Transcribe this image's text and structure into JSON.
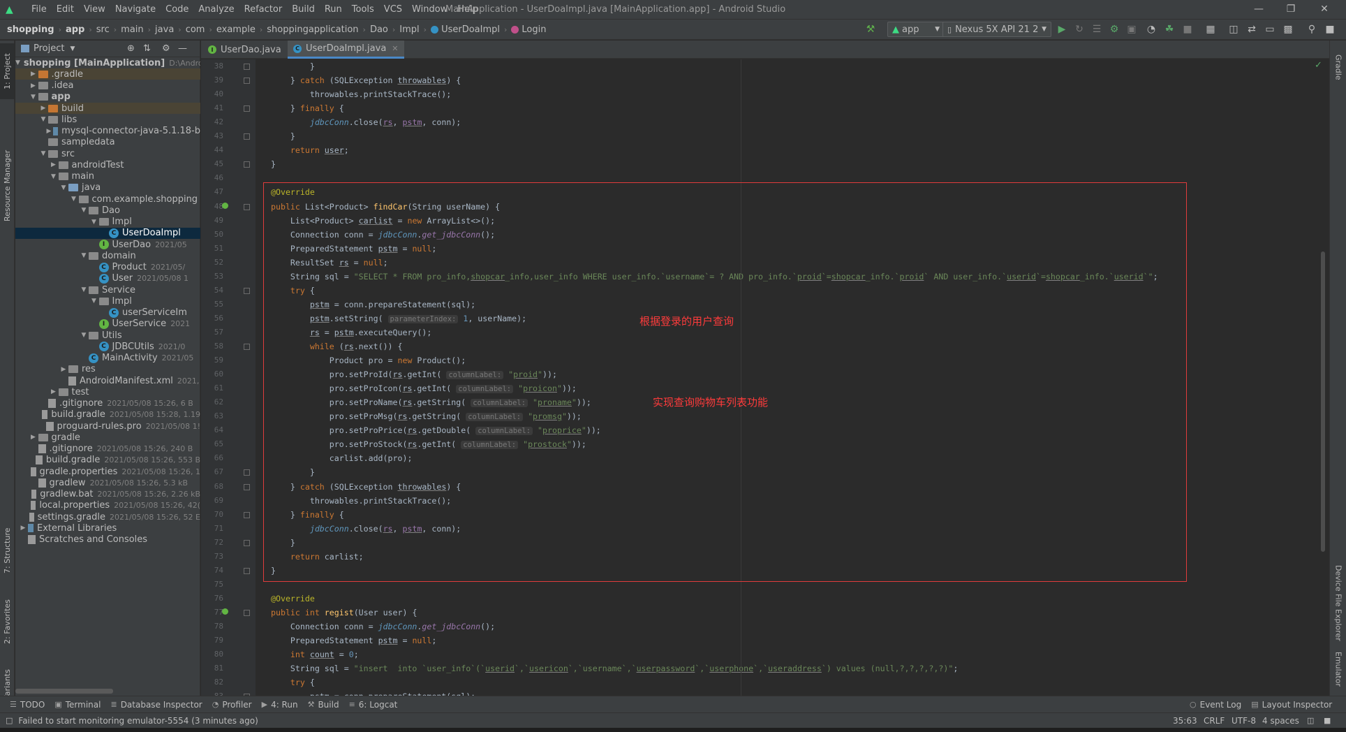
{
  "menubar": {
    "items": [
      "File",
      "Edit",
      "View",
      "Navigate",
      "Code",
      "Analyze",
      "Refactor",
      "Build",
      "Run",
      "Tools",
      "VCS",
      "Window",
      "Help"
    ],
    "title": "MainApplication - UserDoaImpl.java [MainApplication.app] - Android Studio"
  },
  "breadcrumb": [
    "shopping",
    "app",
    "src",
    "main",
    "java",
    "com",
    "example",
    "shoppingapplication",
    "Dao",
    "Impl",
    "UserDoaImpl",
    "Login"
  ],
  "toolbar": {
    "config": "app",
    "device": "Nexus 5X API 21 2"
  },
  "left_tabs": {
    "project": "1: Project",
    "resource": "Resource Manager",
    "structure": "7: Structure",
    "favorites": "2: Favorites",
    "variants": "Build Variants"
  },
  "right_tabs": {
    "gradle": "Gradle",
    "device_explorer": "Device File Explorer",
    "emulator": "Emulator"
  },
  "project_panel": {
    "title": "Project"
  },
  "tree": [
    {
      "label": "shopping [MainApplication]",
      "meta": "D:\\Andro",
      "depth": 0,
      "arrow": "open",
      "icon": "folder",
      "bold": true
    },
    {
      "label": ".gradle",
      "meta": "",
      "depth": 1,
      "arrow": "closed",
      "icon": "folder-o",
      "hl": true
    },
    {
      "label": ".idea",
      "meta": "",
      "depth": 1,
      "arrow": "closed",
      "icon": "folder"
    },
    {
      "label": "app",
      "meta": "",
      "depth": 1,
      "arrow": "open",
      "icon": "folder",
      "bold": true
    },
    {
      "label": "build",
      "meta": "",
      "depth": 2,
      "arrow": "closed",
      "icon": "folder-o",
      "hl": true
    },
    {
      "label": "libs",
      "meta": "",
      "depth": 2,
      "arrow": "open",
      "icon": "folder"
    },
    {
      "label": "mysql-connector-java-5.1.18-b",
      "meta": "",
      "depth": 3,
      "arrow": "closed",
      "icon": "lib"
    },
    {
      "label": "sampledata",
      "meta": "",
      "depth": 2,
      "arrow": "",
      "icon": "folder"
    },
    {
      "label": "src",
      "meta": "",
      "depth": 2,
      "arrow": "open",
      "icon": "folder"
    },
    {
      "label": "androidTest",
      "meta": "",
      "depth": 3,
      "arrow": "closed",
      "icon": "folder"
    },
    {
      "label": "main",
      "meta": "",
      "depth": 3,
      "arrow": "open",
      "icon": "folder"
    },
    {
      "label": "java",
      "meta": "",
      "depth": 4,
      "arrow": "open",
      "icon": "folder-b"
    },
    {
      "label": "com.example.shopping",
      "meta": "",
      "depth": 5,
      "arrow": "open",
      "icon": "folder"
    },
    {
      "label": "Dao",
      "meta": "",
      "depth": 6,
      "arrow": "open",
      "icon": "folder"
    },
    {
      "label": "Impl",
      "meta": "",
      "depth": 7,
      "arrow": "open",
      "icon": "folder"
    },
    {
      "label": "UserDoaImpl",
      "meta": "",
      "depth": 8,
      "arrow": "",
      "icon": "cls",
      "sel": true
    },
    {
      "label": "UserDao",
      "meta": "2021/05",
      "depth": 7,
      "arrow": "",
      "icon": "int"
    },
    {
      "label": "domain",
      "meta": "",
      "depth": 6,
      "arrow": "open",
      "icon": "folder"
    },
    {
      "label": "Product",
      "meta": "2021/05/",
      "depth": 7,
      "arrow": "",
      "icon": "cls"
    },
    {
      "label": "User",
      "meta": "2021/05/08 1",
      "depth": 7,
      "arrow": "",
      "icon": "cls"
    },
    {
      "label": "Service",
      "meta": "",
      "depth": 6,
      "arrow": "open",
      "icon": "folder"
    },
    {
      "label": "Impl",
      "meta": "",
      "depth": 7,
      "arrow": "open",
      "icon": "folder"
    },
    {
      "label": "userServiceIm",
      "meta": "",
      "depth": 8,
      "arrow": "",
      "icon": "cls"
    },
    {
      "label": "UserService",
      "meta": "2021",
      "depth": 7,
      "arrow": "",
      "icon": "int"
    },
    {
      "label": "Utils",
      "meta": "",
      "depth": 6,
      "arrow": "open",
      "icon": "folder"
    },
    {
      "label": "JDBCUtils",
      "meta": "2021/0",
      "depth": 7,
      "arrow": "",
      "icon": "cls"
    },
    {
      "label": "MainActivity",
      "meta": "2021/05",
      "depth": 6,
      "arrow": "",
      "icon": "cls"
    },
    {
      "label": "res",
      "meta": "",
      "depth": 4,
      "arrow": "closed",
      "icon": "folder"
    },
    {
      "label": "AndroidManifest.xml",
      "meta": "2021,",
      "depth": 4,
      "arrow": "",
      "icon": "file"
    },
    {
      "label": "test",
      "meta": "",
      "depth": 3,
      "arrow": "closed",
      "icon": "folder"
    },
    {
      "label": ".gitignore",
      "meta": "2021/05/08 15:26, 6 B",
      "depth": 2,
      "arrow": "",
      "icon": "file"
    },
    {
      "label": "build.gradle",
      "meta": "2021/05/08 15:28, 1.19",
      "depth": 2,
      "arrow": "",
      "icon": "file"
    },
    {
      "label": "proguard-rules.pro",
      "meta": "2021/05/08 1!",
      "depth": 2,
      "arrow": "",
      "icon": "file"
    },
    {
      "label": "gradle",
      "meta": "",
      "depth": 1,
      "arrow": "closed",
      "icon": "folder"
    },
    {
      "label": ".gitignore",
      "meta": "2021/05/08 15:26, 240 B",
      "depth": 1,
      "arrow": "",
      "icon": "file"
    },
    {
      "label": "build.gradle",
      "meta": "2021/05/08 15:26, 553 B",
      "depth": 1,
      "arrow": "",
      "icon": "file"
    },
    {
      "label": "gradle.properties",
      "meta": "2021/05/08 15:26, 1",
      "depth": 1,
      "arrow": "",
      "icon": "file"
    },
    {
      "label": "gradlew",
      "meta": "2021/05/08 15:26, 5.3 kB",
      "depth": 1,
      "arrow": "",
      "icon": "file"
    },
    {
      "label": "gradlew.bat",
      "meta": "2021/05/08 15:26, 2.26 kB",
      "depth": 1,
      "arrow": "",
      "icon": "file"
    },
    {
      "label": "local.properties",
      "meta": "2021/05/08 15:26, 42(",
      "depth": 1,
      "arrow": "",
      "icon": "file"
    },
    {
      "label": "settings.gradle",
      "meta": "2021/05/08 15:26, 52 E",
      "depth": 1,
      "arrow": "",
      "icon": "file"
    },
    {
      "label": "External Libraries",
      "meta": "",
      "depth": 0,
      "arrow": "closed",
      "icon": "lib"
    },
    {
      "label": "Scratches and Consoles",
      "meta": "",
      "depth": 0,
      "arrow": "",
      "icon": "file"
    }
  ],
  "editor_tabs": [
    {
      "label": "UserDao.java",
      "kind": "int"
    },
    {
      "label": "UserDoaImpl.java",
      "kind": "cls",
      "active": true
    }
  ],
  "line_start": 38,
  "code_lines": [
    "        }",
    "    } <k>catch</k> (SQLException <u>throwables</u>) {",
    "        throwables.printStackTrace();",
    "    } <k>finally</k> {",
    "        <s2>jdbcConn</s2>.close(<fu>rs</fu>, <fu>pstm</fu>, conn);",
    "    }",
    "    <k>return</k> <u>user</u>;",
    "}",
    "",
    "<a>@Override</a>",
    "<k>public</k> List&lt;Product&gt; <f>findCar</f>(String userName) {",
    "    List&lt;Product&gt; <u>carlist</u> = <k>new</k> ArrayList&lt;&gt;();",
    "    Connection conn = <s2>jdbcConn</s2>.<i>get_jdbcConn</i>();",
    "    PreparedStatement <u>pstm</u> = <k>null</k>;",
    "    ResultSet <u>rs</u> = <k>null</k>;",
    "    String sql = <q>\"SELECT * FROM pro_info,<uq>shopcar</uq>_info,user_info WHERE user_info.`username`= ? AND pro_info.`<uq>proid</uq>`=<uq>shopcar</uq>_info.`<uq>proid</uq>` AND user_info.`<uq>userid</uq>`=<uq>shopcar</uq>_info.`<uq>userid</uq>`\"</q>;",
    "    <k>try</k> {",
    "        <u>pstm</u> = conn.prepareStatement(sql);",
    "        <u>pstm</u>.setString( <h>parameterIndex:</h> <n>1</n>, userName);",
    "        <u>rs</u> = <u>pstm</u>.executeQuery();",
    "        <k>while</k> (<u>rs</u>.next()) {",
    "            Product pro = <k>new</k> Product();",
    "            pro.setProId(<u>rs</u>.getInt( <h>columnLabel:</h> <q>\"<uq>proid</uq>\"</q>));",
    "            pro.setProIcon(<u>rs</u>.getInt( <h>columnLabel:</h> <q>\"<uq>proicon</uq>\"</q>));",
    "            pro.setProName(<u>rs</u>.getString( <h>columnLabel:</h> <q>\"<uq>proname</uq>\"</q>));",
    "            pro.setProMsg(<u>rs</u>.getString( <h>columnLabel:</h> <q>\"<uq>promsg</uq>\"</q>));",
    "            pro.setProPrice(<u>rs</u>.getDouble( <h>columnLabel:</h> <q>\"<uq>proprice</uq>\"</q>));",
    "            pro.setProStock(<u>rs</u>.getInt( <h>columnLabel:</h> <q>\"<uq>prostock</uq>\"</q>));",
    "            carlist.add(pro);",
    "        }",
    "    } <k>catch</k> (SQLException <u>throwables</u>) {",
    "        throwables.printStackTrace();",
    "    } <k>finally</k> {",
    "        <s2>jdbcConn</s2>.close(<fu>rs</fu>, <fu>pstm</fu>, conn);",
    "    }",
    "    <k>return</k> carlist;",
    "}",
    "",
    "<a>@Override</a>",
    "<k>public int</k> <f>regist</f>(User user) {",
    "    Connection conn = <s2>jdbcConn</s2>.<i>get_jdbcConn</i>();",
    "    PreparedStatement <u>pstm</u> = <k>null</k>;",
    "    <k>int</k> <u>count</u> = <n>0</n>;",
    "    String sql = <q>\"insert  into `user_info`(`<uq>userid</uq>`,`<uq>usericon</uq>`,`username`,`<uq>userpassword</uq>`,`<uq>userphone</uq>`,`<uq>useraddress</uq>`) values (null,?,?,?,?,?)\"</q>;",
    "    <k>try</k> {",
    "        pstm = conn.prepareStatement(sql);"
  ],
  "annotations": {
    "note1": "根据登录的用户查询",
    "note2": "实现查询购物车列表功能"
  },
  "toolwindows": [
    "TODO",
    "Terminal",
    "Database Inspector",
    "Profiler",
    "4: Run",
    "Build",
    "6: Logcat"
  ],
  "toolwindows_right": [
    "Event Log",
    "Layout Inspector"
  ],
  "status": {
    "message": "Failed to start monitoring emulator-5554 (3 minutes ago)",
    "position": "35:63",
    "line_sep": "CRLF",
    "encoding": "UTF-8",
    "indent": "4 spaces"
  },
  "colors": {
    "accent": "#4a88c7",
    "annotation_box": "#e03c3c"
  }
}
